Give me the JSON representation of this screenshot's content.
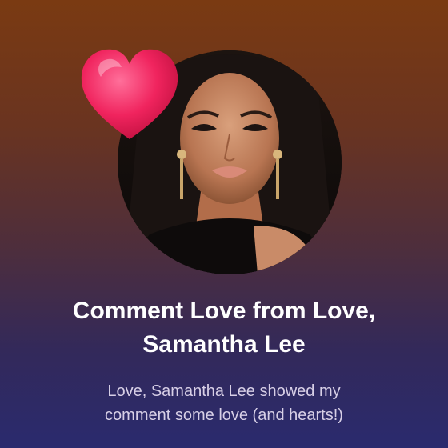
{
  "notification": {
    "title_line1": "Comment Love from Love,",
    "title_line2": "Samantha Lee",
    "message_line1": "Love, Samantha Lee showed my",
    "message_line2": "comment some love (and hearts!)"
  },
  "icons": {
    "heart": "heart-icon"
  },
  "colors": {
    "background_top": "#7a3a12",
    "background_bottom": "#2a2a6e",
    "heart": "#f0245e",
    "title": "#ffffff",
    "message": "#d7cfe6"
  }
}
